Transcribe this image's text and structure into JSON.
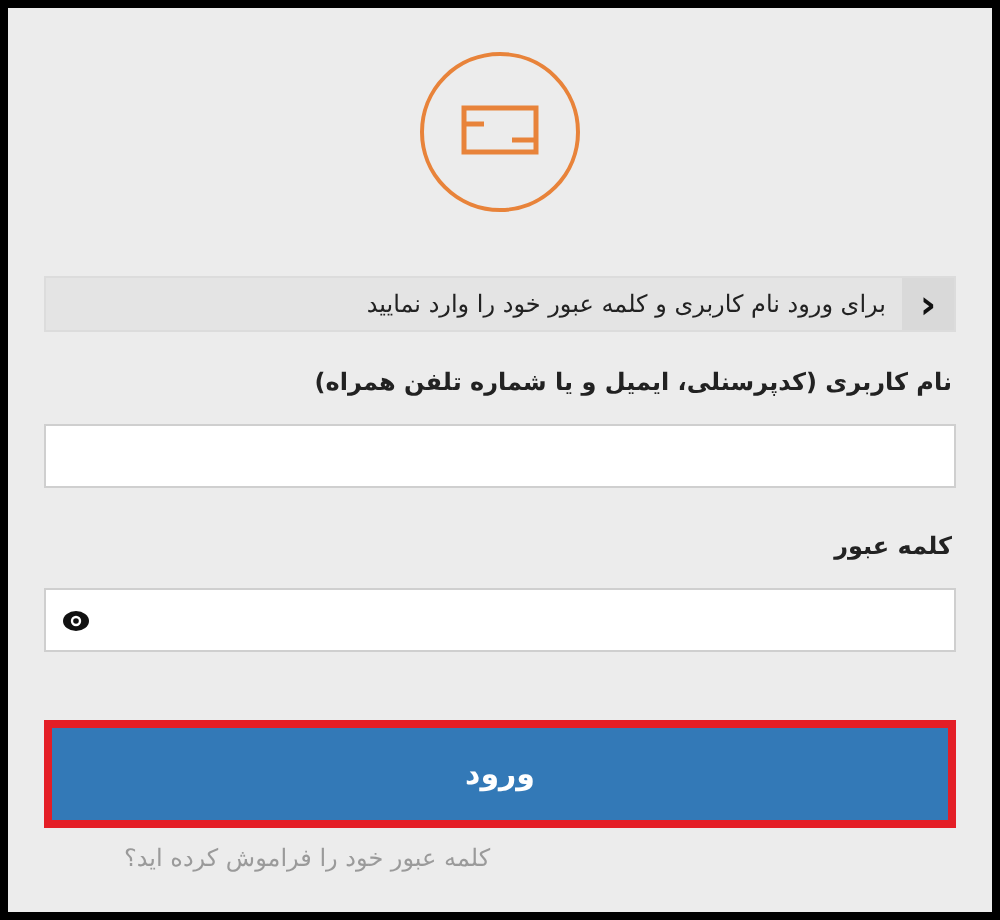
{
  "notice": {
    "text": "برای ورود نام کاربری و کلمه عبور خود را وارد نمایید",
    "icon": "‹"
  },
  "fields": [
    {
      "label": "نام کاربری (کدپرسنلی، ایمیل و یا شماره تلفن همراه)",
      "kind": "text"
    },
    {
      "label": "کلمه عبور",
      "kind": "password"
    }
  ],
  "submit": {
    "label": "ورود",
    "highlighted": true
  },
  "forgot_link": "کلمه عبور خود را فراموش کرده اید؟"
}
